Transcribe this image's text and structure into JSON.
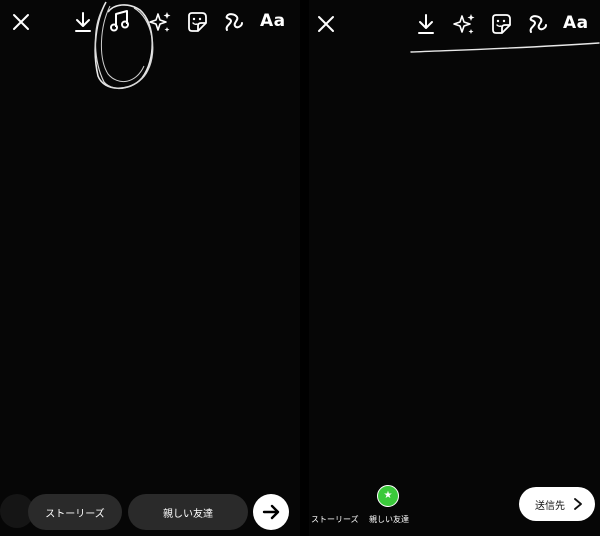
{
  "left_panel": {
    "toolbar": {
      "close_icon": "close-icon",
      "icons": [
        "download-icon",
        "music-note-icon",
        "sparkles-icon",
        "sticker-icon",
        "draw-icon"
      ],
      "text_label": "Aa"
    },
    "bottom_bar": {
      "stories_label": "ストーリーズ",
      "close_friends_label": "親しい友達",
      "next_icon": "arrow-right-icon"
    }
  },
  "right_panel": {
    "toolbar": {
      "close_icon": "close-icon",
      "icons": [
        "download-icon",
        "sparkles-icon",
        "sticker-icon",
        "draw-icon"
      ],
      "text_label": "Aa"
    },
    "bottom_bar": {
      "stories_label": "ストーリーズ",
      "close_friends_label": "親しい友達",
      "close_friends_badge": "★",
      "send_label": "送信先",
      "send_icon": "chevron-right-icon"
    }
  },
  "colors": {
    "background": "#060606",
    "pill": "#2a2a2a",
    "close_friends_green": "#3bc93b",
    "icon": "#ffffff"
  }
}
